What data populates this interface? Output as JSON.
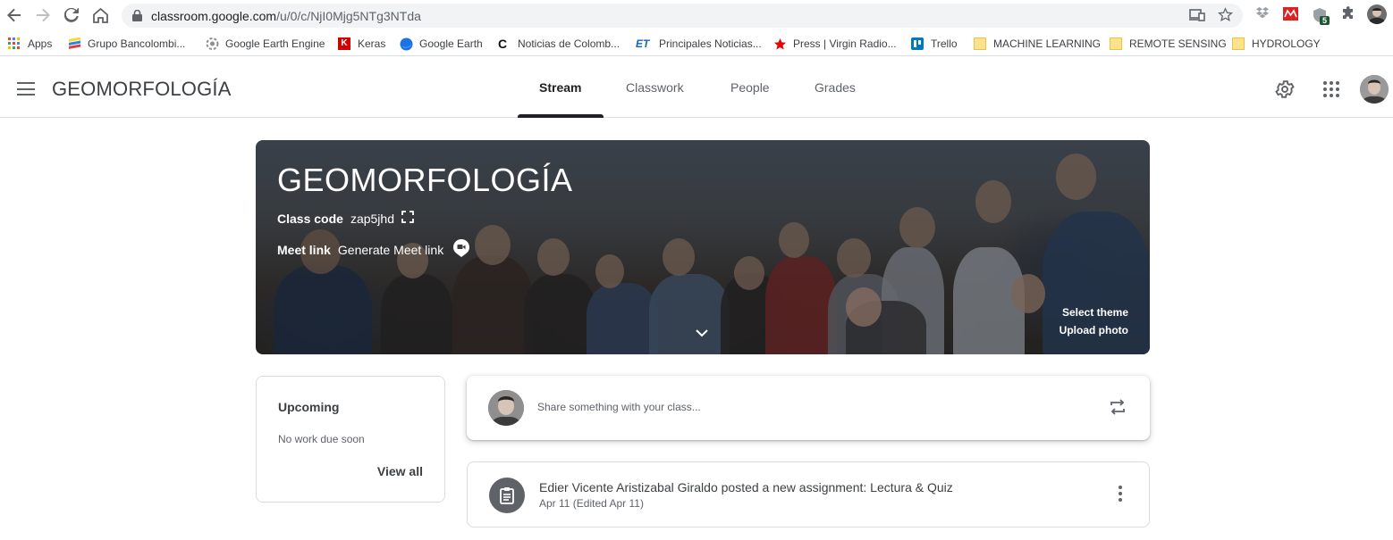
{
  "browser": {
    "url_host": "classroom.google.com",
    "url_path": "/u/0/c/NjI0Mjg5NTg3NTda",
    "extension_badge": "5",
    "bookmarks": [
      {
        "label": "Apps",
        "icon": "apps-grid-icon"
      },
      {
        "label": "Grupo Bancolombi...",
        "icon": "bancolombia-icon"
      },
      {
        "label": "Google Earth Engine",
        "icon": "earth-engine-icon"
      },
      {
        "label": "Keras",
        "icon": "keras-icon"
      },
      {
        "label": "Google Earth",
        "icon": "google-earth-icon"
      },
      {
        "label": "Noticias de Colomb...",
        "icon": "noticias-icon"
      },
      {
        "label": "Principales Noticias...",
        "icon": "et-icon"
      },
      {
        "label": "Press | Virgin Radio...",
        "icon": "star-icon"
      },
      {
        "label": "Trello",
        "icon": "trello-icon"
      },
      {
        "label": "MACHINE LEARNING",
        "icon": "folder-icon"
      },
      {
        "label": "REMOTE SENSING",
        "icon": "folder-icon"
      },
      {
        "label": "HYDROLOGY",
        "icon": "folder-icon"
      }
    ]
  },
  "header": {
    "class_name": "GEOMORFOLOGÍA",
    "tabs": [
      {
        "label": "Stream",
        "active": true
      },
      {
        "label": "Classwork",
        "active": false
      },
      {
        "label": "People",
        "active": false
      },
      {
        "label": "Grades",
        "active": false
      }
    ]
  },
  "banner": {
    "title": "GEOMORFOLOGÍA",
    "class_code_label": "Class code",
    "class_code": "zap5jhd",
    "meet_label": "Meet link",
    "meet_action": "Generate Meet link",
    "select_theme": "Select theme",
    "upload_photo": "Upload photo"
  },
  "upcoming": {
    "title": "Upcoming",
    "empty_text": "No work due soon",
    "view_all": "View all"
  },
  "share": {
    "placeholder": "Share something with your class..."
  },
  "posts": [
    {
      "title": "Edier Vicente Aristizabal Giraldo posted a new assignment: Lectura & Quiz",
      "date": "Apr 11 (Edited Apr 11)"
    }
  ],
  "colors": {
    "text_primary": "#3c4043",
    "text_secondary": "#5f6368",
    "border": "#dadce0"
  }
}
